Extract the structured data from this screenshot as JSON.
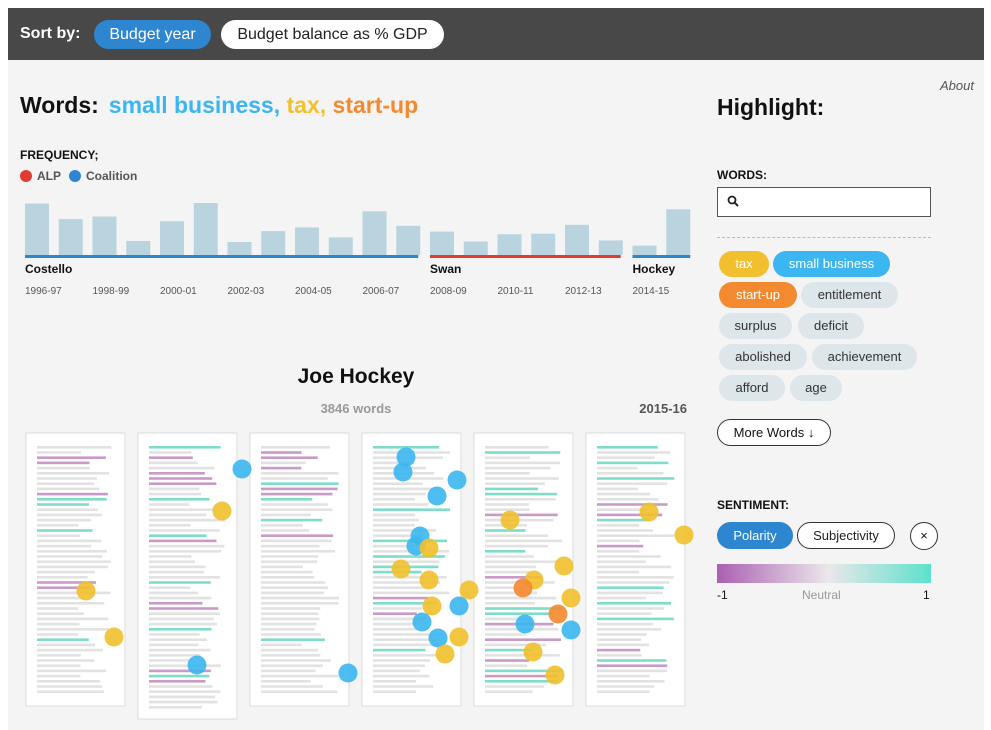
{
  "topbar": {
    "sort_by": "Sort by:",
    "sort_options": [
      "Budget year",
      "Budget balance as % GDP"
    ]
  },
  "about": "About",
  "words": {
    "label": "Words:",
    "items": [
      {
        "text": "small business",
        "sep": ",",
        "color": "#3bb6f0"
      },
      {
        "text": "tax",
        "sep": ",",
        "color": "#f2c02e"
      },
      {
        "text": "start-up",
        "sep": "",
        "color": "#f48a2f"
      }
    ]
  },
  "frequency": {
    "label": "FREQUENCY;",
    "legend": [
      {
        "name": "ALP",
        "color": "#e03c31"
      },
      {
        "name": "Coalition",
        "color": "#2f86d0"
      }
    ]
  },
  "chart_data": {
    "type": "bar",
    "values": [
      0.99,
      0.69,
      0.74,
      0.27,
      0.65,
      1.0,
      0.25,
      0.46,
      0.53,
      0.34,
      0.84,
      0.56,
      0.45,
      0.26,
      0.4,
      0.41,
      0.58,
      0.28,
      0.18,
      0.88
    ],
    "party": [
      "Coalition",
      "Coalition",
      "Coalition",
      "Coalition",
      "Coalition",
      "Coalition",
      "Coalition",
      "Coalition",
      "Coalition",
      "Coalition",
      "Coalition",
      "Coalition",
      "ALP",
      "ALP",
      "ALP",
      "ALP",
      "ALP",
      "ALP",
      "Coalition",
      "Coalition"
    ],
    "treasurers": [
      {
        "name": "Costello",
        "start": 0
      },
      {
        "name": "Swan",
        "start": 12
      },
      {
        "name": "Hockey",
        "start": 18
      }
    ],
    "tick_labels": [
      {
        "label": "1996-97",
        "index": 0
      },
      {
        "label": "1998-99",
        "index": 2
      },
      {
        "label": "2000-01",
        "index": 4
      },
      {
        "label": "2002-03",
        "index": 6
      },
      {
        "label": "2004-05",
        "index": 8
      },
      {
        "label": "2006-07",
        "index": 10
      },
      {
        "label": "2008-09",
        "index": 12
      },
      {
        "label": "2010-11",
        "index": 14
      },
      {
        "label": "2012-13",
        "index": 16
      },
      {
        "label": "2014-15",
        "index": 18
      }
    ],
    "bar_color": "#b9d4df"
  },
  "highlight": {
    "title": "Highlight:",
    "words_label": "WORDS:",
    "search_value": "",
    "tags": [
      {
        "label": "tax",
        "bg": "#f2c02e",
        "fg": "#ffffff"
      },
      {
        "label": "small business",
        "bg": "#3bb6f0",
        "fg": "#ffffff"
      },
      {
        "label": "start-up",
        "bg": "#f48a2f",
        "fg": "#ffffff"
      },
      {
        "label": "entitlement",
        "bg": "#dde6ea",
        "fg": "#333333"
      },
      {
        "label": "surplus",
        "bg": "#dde6ea",
        "fg": "#333333"
      },
      {
        "label": "deficit",
        "bg": "#dde6ea",
        "fg": "#333333"
      },
      {
        "label": "abolished",
        "bg": "#dde6ea",
        "fg": "#333333"
      },
      {
        "label": "achievement",
        "bg": "#dde6ea",
        "fg": "#333333"
      },
      {
        "label": "afford",
        "bg": "#dde6ea",
        "fg": "#333333"
      },
      {
        "label": "age",
        "bg": "#dde6ea",
        "fg": "#333333"
      }
    ],
    "more_words": "More Words ↓",
    "sentiment_label": "SENTIMENT:",
    "sentiment_buttons": [
      "Polarity",
      "Subjectivity"
    ],
    "close": "×",
    "scale": {
      "min": "-1",
      "mid": "Neutral",
      "max": "1"
    }
  },
  "speech": {
    "speaker": "Joe Hockey",
    "word_count": "3846 words",
    "year": "2015-16"
  },
  "colors": {
    "small_business": "#3bb6f0",
    "tax": "#f2c02e",
    "start_up": "#f48a2f",
    "positive": "#7edccb",
    "negative": "#c99ac8",
    "neutral": "#e2e2e2"
  }
}
